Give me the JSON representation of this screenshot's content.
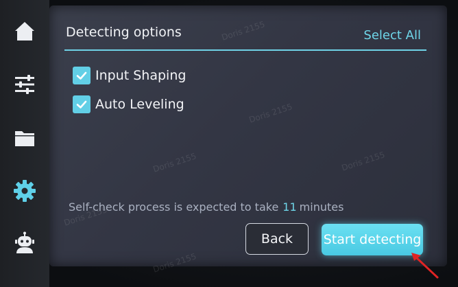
{
  "sidebar": {
    "items": [
      {
        "name": "home",
        "icon": "home-icon"
      },
      {
        "name": "settings-sliders",
        "icon": "sliders-icon"
      },
      {
        "name": "files",
        "icon": "folder-icon"
      },
      {
        "name": "system",
        "icon": "gear-icon",
        "active": true
      },
      {
        "name": "assistant",
        "icon": "robot-icon"
      }
    ]
  },
  "panel": {
    "title": "Detecting options",
    "select_all_label": "Select All",
    "options": [
      {
        "label": "Input Shaping",
        "checked": true
      },
      {
        "label": "Auto Leveling",
        "checked": true
      }
    ],
    "estimate": {
      "prefix": "Self-check process is expected to take",
      "value": "11",
      "suffix": "minutes"
    }
  },
  "buttons": {
    "back_label": "Back",
    "start_label": "Start detecting"
  },
  "watermark_text": "Doris 2155",
  "colors": {
    "accent": "#62cfe6",
    "active_icon": "#5fd0e8",
    "icon": "#eceef2",
    "arrow": "#e02424"
  }
}
